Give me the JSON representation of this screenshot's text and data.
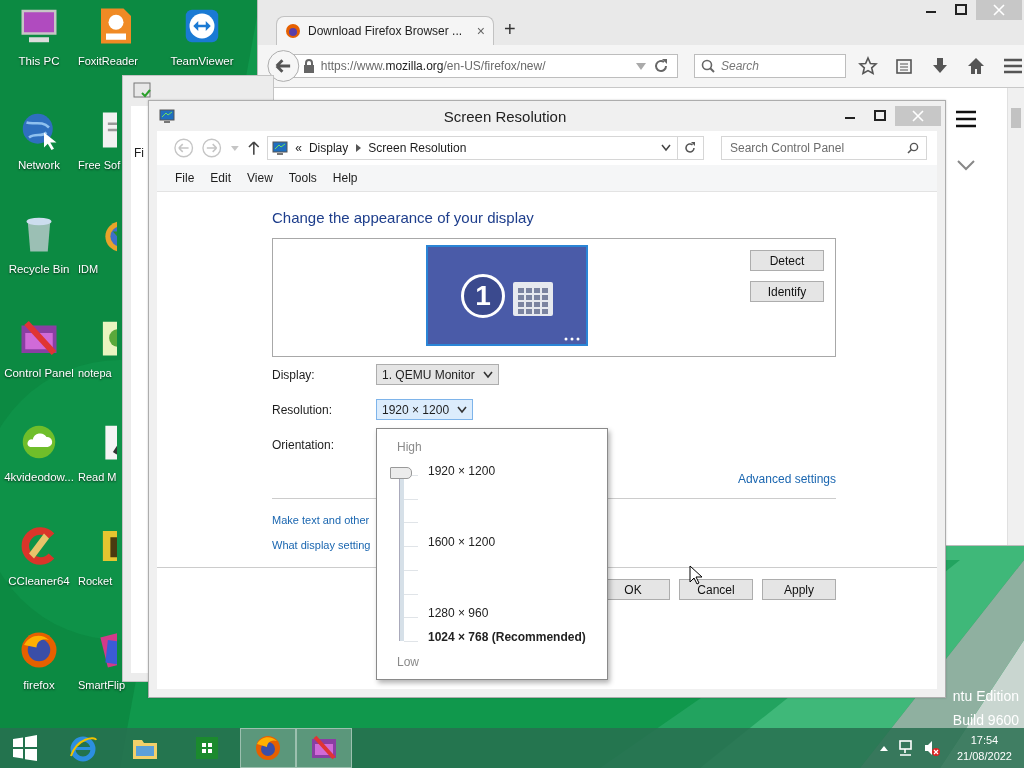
{
  "desktop": {
    "icons": [
      {
        "label": "This PC"
      },
      {
        "label": "FoxitReader"
      },
      {
        "label": "TeamViewer"
      },
      {
        "label": "Network"
      },
      {
        "label": "Free Sof"
      },
      {
        "label": "Recycle Bin"
      },
      {
        "label": "IDM"
      },
      {
        "label": "Control Panel"
      },
      {
        "label": "notepa"
      },
      {
        "label": "4kvideodow..."
      },
      {
        "label": "Read M"
      },
      {
        "label": "CCleaner64"
      },
      {
        "label": "Rocket"
      },
      {
        "label": "firefox"
      },
      {
        "label": "SmartFlip"
      }
    ],
    "edition_lines": [
      "ntu Edition",
      "Build 9600"
    ]
  },
  "browser": {
    "tabs": [
      {
        "title": "Download Firefox Browser ...",
        "selected": true,
        "close": "×"
      }
    ],
    "new_tab": "+",
    "url": "https://www.**mozilla.org**/en-US/firefox/new/",
    "search": {
      "placeholder": "Search"
    }
  },
  "background_window": {
    "menu_fragment": "Fi"
  },
  "dialog": {
    "title": "Screen Resolution",
    "breadcrumb_prefix": "«",
    "breadcrumb": [
      "Display",
      "Screen Resolution"
    ],
    "search": {
      "placeholder": "Search Control Panel"
    },
    "menu": [
      "File",
      "Edit",
      "View",
      "Tools",
      "Help"
    ],
    "heading": "Change the appearance of your display",
    "monitor_number": "1",
    "side_buttons": [
      "Detect",
      "Identify"
    ],
    "fields": [
      {
        "label": "Display:",
        "value": "1. QEMU Monitor",
        "expanded": false
      },
      {
        "label": "Resolution:",
        "value": "1920 × 1200",
        "expanded": true
      },
      {
        "label": "Orientation:"
      }
    ],
    "advanced_link": "Advanced settings",
    "links": [
      "Make text and other",
      "What display setting"
    ],
    "buttons": [
      "OK",
      "Cancel",
      "Apply"
    ],
    "resolution_popup": {
      "high_label": "High",
      "low_label": "Low",
      "level": 1,
      "options": [
        {
          "label": "1920 × 1200",
          "recommended": false
        },
        {
          "label": "1600 × 1200",
          "recommended": false
        },
        {
          "label": "1280 × 960",
          "recommended": false
        },
        {
          "label": "1024 × 768 (Recommended)",
          "recommended": true
        }
      ]
    }
  },
  "taskbar": {
    "apps": [
      {
        "active": false
      },
      {
        "active": false
      },
      {
        "active": false
      },
      {
        "active": false
      },
      {
        "active": true
      },
      {
        "active": true
      }
    ],
    "clock": {
      "time": "17:54",
      "date": "21/08/2022"
    }
  }
}
